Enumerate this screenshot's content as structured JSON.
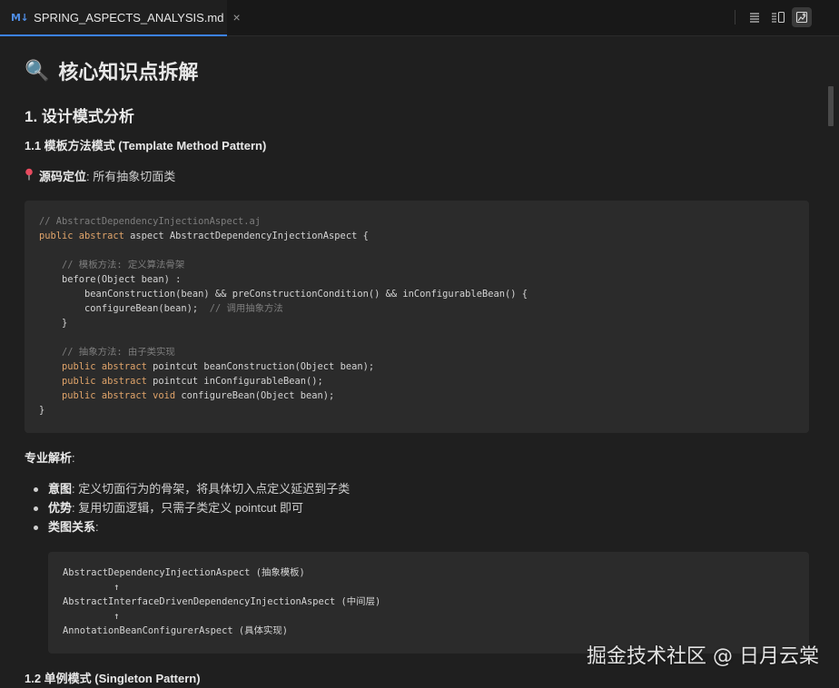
{
  "tab": {
    "icon_text": "M↓",
    "title": "SPRING_ASPECTS_ANALYSIS.md",
    "close": "×"
  },
  "toolbar": {
    "icons": [
      "list-icon",
      "split-preview-icon",
      "preview-icon"
    ]
  },
  "doc": {
    "title_emoji": "🔍",
    "title": "核心知识点拆解",
    "h2": "1. 设计模式分析",
    "h3_1": "1.1 模板方法模式 (Template Method Pattern)",
    "src_label": "源码定位",
    "src_text": ": 所有抽象切面类",
    "analysis_label": "专业解析",
    "analysis_colon": ":",
    "bullets": [
      {
        "label": "意图",
        "text": ": 定义切面行为的骨架，将具体切入点定义延迟到子类"
      },
      {
        "label": "优势",
        "text": ": 复用切面逻辑，只需子类定义 pointcut 即可"
      },
      {
        "label": "类图关系",
        "text": ":"
      }
    ],
    "class_diagram": [
      "AbstractDependencyInjectionAspect (抽象模板)",
      "         ↑",
      "AbstractInterfaceDrivenDependencyInjectionAspect (中间层)",
      "         ↑",
      "AnnotationBeanConfigurerAspect (具体实现)"
    ],
    "h3_2": "1.2 单例模式 (Singleton Pattern)"
  },
  "code": {
    "line1": "// AbstractDependencyInjectionAspect.aj",
    "line2_kw": "public abstract",
    "line2_rest": " aspect AbstractDependencyInjectionAspect {",
    "line3": "// 模板方法: 定义算法骨架",
    "line4": "before(Object bean) :",
    "line5": "beanConstruction(bean) && preConstructionCondition() && inConfigurableBean() {",
    "line6": "configureBean(bean);",
    "line6_cm": "// 调用抽象方法",
    "line7": "}",
    "line8": "// 抽象方法: 由子类实现",
    "line9_kw": "public abstract",
    "line9_rest": " pointcut beanConstruction(Object bean);",
    "line10_kw": "public abstract",
    "line10_rest": " pointcut inConfigurableBean();",
    "line11_kw": "public abstract void",
    "line11_rest": " configureBean(Object bean);",
    "line12": "}"
  },
  "watermark": "掘金技术社区 @ 日月云棠"
}
